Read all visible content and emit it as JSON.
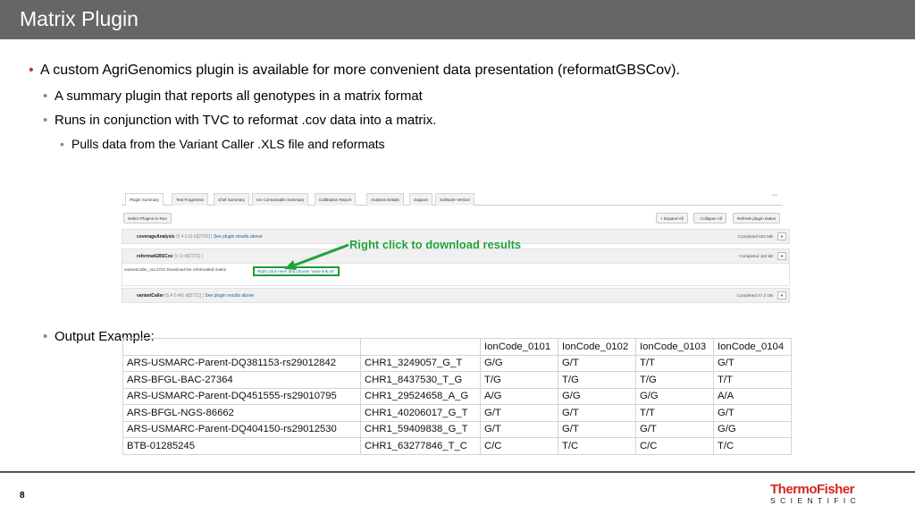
{
  "title": "Matrix Plugin",
  "bullets": {
    "b1": "A custom AgriGenomics plugin is available for more convenient data presentation (reformatGBSCov).",
    "b2": "A summary plugin that reports all genotypes in a matrix format",
    "b3": "Runs in conjunction with TVC to reformat .cov data into a matrix.",
    "b4": "Pulls data from the Variant Caller .XLS file and reformats",
    "b5": "Output Example:"
  },
  "plugin_ui": {
    "tabs": [
      "Plugin Summary",
      "Test Fragments",
      "Chef Summary",
      "Ion Consumable Summary",
      "Calibration Report",
      "Analysis Details",
      "Support",
      "Software Version"
    ],
    "tab_more": "<<",
    "select_button": "Select Plugins to Run",
    "expand_all": "+ Expand All",
    "collapse_all": "- Collapse All",
    "refresh": "Refresh plugin status",
    "plugins": [
      {
        "name": "coverageAnalysis",
        "meta": "(5.4.0.5) id[2720] |",
        "link": "See plugin results above",
        "status": "Completed 602 MB"
      },
      {
        "name": "reformatGBSCov",
        "meta": "(v 1) id[2721] |",
        "link": "",
        "status": "Completed 183 kB"
      },
      {
        "name": "variantCaller",
        "meta": "(5.4.0.46) id[2721] |",
        "link": "See plugin results above",
        "status": "Completed 47.2 GB"
      }
    ],
    "detail_text": "variantCaller_out.2721 Download the reformatted matrix",
    "detail_link": "Right Click Here and choose \"save link as\"",
    "annotation": "Right click to download results"
  },
  "matrix": {
    "header": [
      "",
      "",
      "IonCode_0101",
      "IonCode_0102",
      "IonCode_0103",
      "IonCode_0104"
    ],
    "rows": [
      [
        "ARS-USMARC-Parent-DQ381153-rs29012842",
        "CHR1_3249057_G_T",
        "G/G",
        "G/T",
        "T/T",
        "G/T"
      ],
      [
        "ARS-BFGL-BAC-27364",
        "CHR1_8437530_T_G",
        "T/G",
        "T/G",
        "T/G",
        "T/T"
      ],
      [
        "ARS-USMARC-Parent-DQ451555-rs29010795",
        "CHR1_29524658_A_G",
        "A/G",
        "G/G",
        "G/G",
        "A/A"
      ],
      [
        "ARS-BFGL-NGS-86662",
        "CHR1_40206017_G_T",
        "G/T",
        "G/T",
        "T/T",
        "G/T"
      ],
      [
        "ARS-USMARC-Parent-DQ404150-rs29012530",
        "CHR1_59409838_G_T",
        "G/T",
        "G/T",
        "G/T",
        "G/G"
      ],
      [
        "BTB-01285245",
        "CHR1_63277846_T_C",
        "C/C",
        "T/C",
        "C/C",
        "T/C"
      ]
    ]
  },
  "footer": {
    "page_number": "8",
    "logo_line1": "ThermoFisher",
    "logo_line2": "SCIENTIFIC"
  },
  "colors": {
    "title_bar": "#666666",
    "bullet_accent": "#d0312d",
    "annotation": "#20a23a",
    "logo_red": "#d7261e"
  }
}
